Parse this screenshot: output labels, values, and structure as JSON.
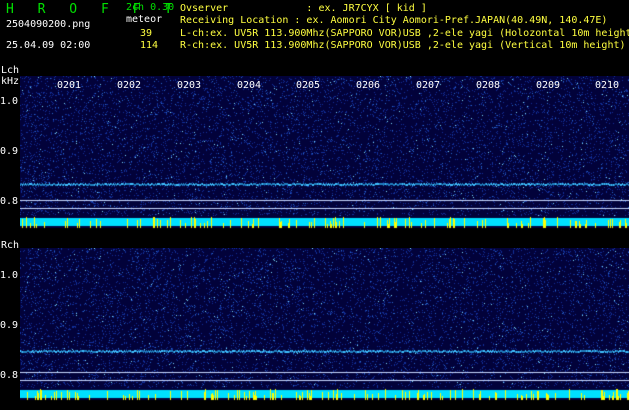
{
  "header": {
    "app_title": "H R O F F T",
    "app_version": "2ch 0.30",
    "filename": "2504090200.png",
    "meteor_label": "meteor",
    "lch_count": "39",
    "rch_count": "114",
    "datetime": "25.04.09 02:00",
    "observer": "Ovserver             : ex. JR7CYX [ kid ]",
    "location": "Receiving Location : ex. Aomori City Aomori-Pref.JAPAN(40.49N, 140.47E)",
    "lch_info": "L-ch:ex. UV5R 113.900Mhz(SAPPORO VOR)USB ,2-ele yagi (Holozontal 10m height)",
    "rch_info": "R-ch:ex. UV5R 113.900Mhz(SAPPORO VOR)USB ,2-ele yagi (Vertical 10m height)"
  },
  "panels": {
    "lch_label": "Lch",
    "khz_label": "kHz",
    "rch_label": "Rch",
    "freq_ticks": [
      "1.0",
      "0.9",
      "0.8"
    ],
    "time_labels": [
      "0201",
      "0202",
      "0203",
      "0204",
      "0205",
      "0206",
      "0207",
      "0208",
      "0209",
      "0210"
    ]
  },
  "colors": {
    "background": "#000000",
    "header_title": "#00e000",
    "text": "#ffffff",
    "count_yellow": "#ffff40",
    "waterfall_bg": "#02023a",
    "noise_bar": "#00e0ff",
    "spike": "#ffff00"
  }
}
